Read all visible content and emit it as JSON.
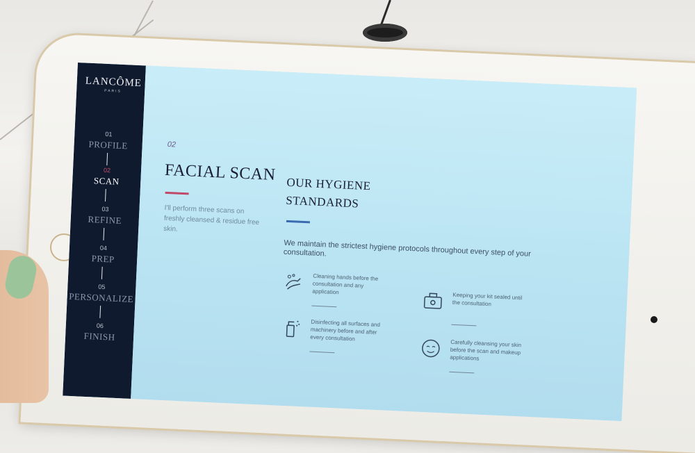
{
  "sidebar": {
    "logo": "LANCÔME",
    "logo_sub": "PARIS",
    "steps": [
      {
        "num": "01",
        "label": "PROFILE"
      },
      {
        "num": "02",
        "label": "SCAN"
      },
      {
        "num": "03",
        "label": "REFINE"
      },
      {
        "num": "04",
        "label": "PREP"
      },
      {
        "num": "05",
        "label": "PERSONALIZE"
      },
      {
        "num": "06",
        "label": "FINISH"
      }
    ]
  },
  "main": {
    "step_number": "02",
    "title": "FACIAL SCAN",
    "intro": "I'll perform three scans on freshly cleansed & residue free skin.",
    "hygiene_title": "OUR HYGIENE STANDARDS",
    "hygiene_description": "We maintain the strictest hygiene protocols throughout every step of your consultation.",
    "items": [
      {
        "icon": "handwash-icon",
        "text": "Cleaning hands before the consultation and any application"
      },
      {
        "icon": "sealed-kit-icon",
        "text": "Keeping your kit sealed until the consultation"
      },
      {
        "icon": "spray-disinfect-icon",
        "text": "Disinfecting all surfaces and machinery before and after every consultation"
      },
      {
        "icon": "face-cleanse-icon",
        "text": "Carefully cleansing your skin before the scan and makeup applications"
      }
    ]
  },
  "colors": {
    "sidebar_bg": "#101a2e",
    "screen_bg": "#bfe6f3",
    "accent_red": "#c2486a",
    "accent_blue": "#3a6ab0"
  }
}
